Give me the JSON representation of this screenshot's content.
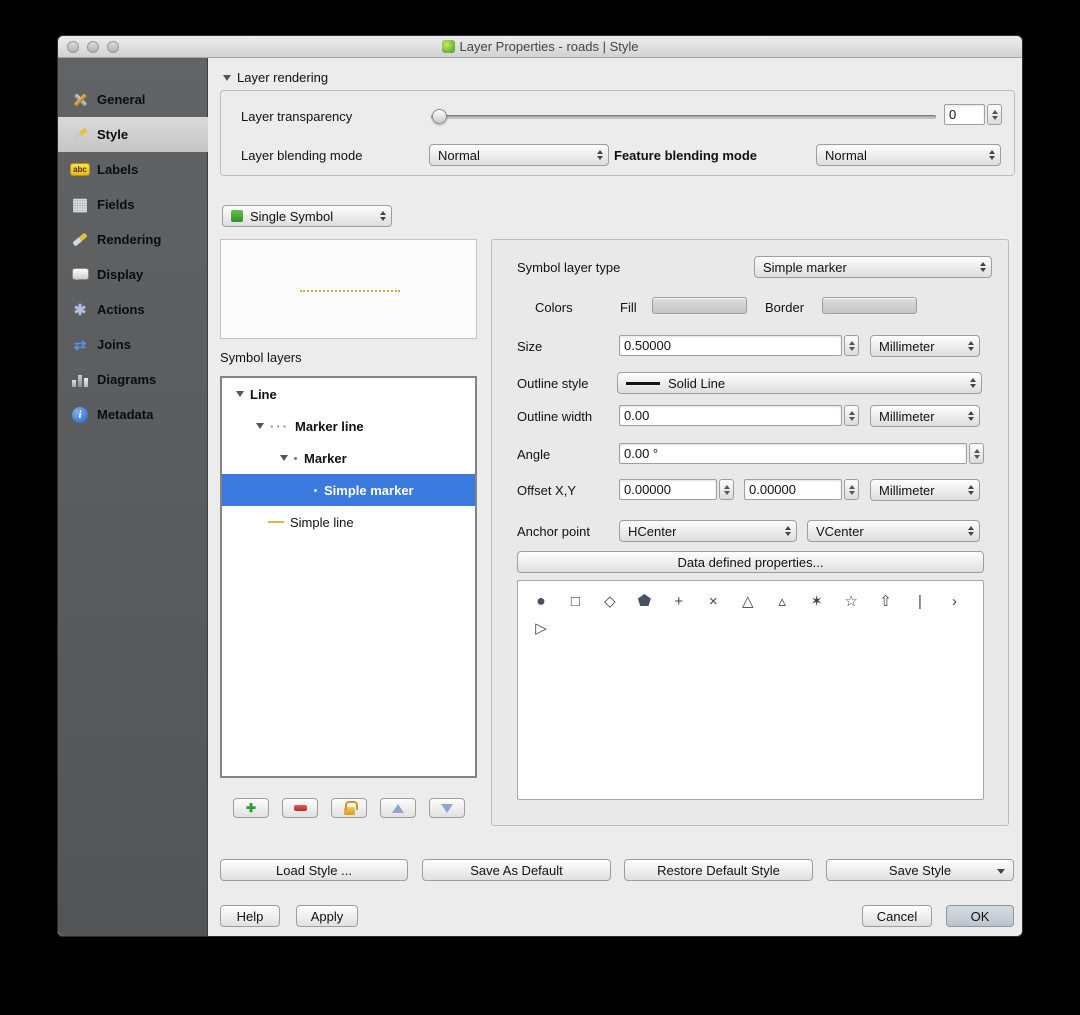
{
  "window": {
    "title": "Layer Properties - roads | Style"
  },
  "theme": {
    "selection_blue": "#3b79de",
    "sidebar_gray": "#58595b",
    "fill_swatch_color": "#d3d3d3",
    "border_swatch_color": "#cccccc",
    "preview_line_color": "#e0a43c"
  },
  "sidebar": {
    "items": [
      {
        "label": "General",
        "icon": "general-icon"
      },
      {
        "label": "Style",
        "icon": "style-icon",
        "selected": true
      },
      {
        "label": "Labels",
        "icon": "labels-icon"
      },
      {
        "label": "Fields",
        "icon": "fields-icon"
      },
      {
        "label": "Rendering",
        "icon": "rendering-icon"
      },
      {
        "label": "Display",
        "icon": "display-icon"
      },
      {
        "label": "Actions",
        "icon": "actions-icon"
      },
      {
        "label": "Joins",
        "icon": "joins-icon"
      },
      {
        "label": "Diagrams",
        "icon": "diagrams-icon"
      },
      {
        "label": "Metadata",
        "icon": "metadata-icon"
      }
    ]
  },
  "layer_rendering": {
    "title": "Layer rendering",
    "transparency_label": "Layer transparency",
    "transparency_value": "0",
    "blending_mode_label": "Layer blending mode",
    "blending_mode_value": "Normal",
    "feature_blending_label": "Feature blending mode",
    "feature_blending_value": "Normal"
  },
  "symbol_selector": {
    "value": "Single Symbol"
  },
  "symbol_layers": {
    "label": "Symbol layers",
    "tree": [
      {
        "label": "Line"
      },
      {
        "label": "Marker line"
      },
      {
        "label": "Marker"
      },
      {
        "label": "Simple marker",
        "selected": true
      },
      {
        "label": "Simple line"
      }
    ]
  },
  "properties": {
    "symbol_layer_type_label": "Symbol layer type",
    "symbol_layer_type_value": "Simple marker",
    "colors_label": "Colors",
    "fill_label": "Fill",
    "border_label": "Border",
    "size_label": "Size",
    "size_value": "0.50000",
    "size_unit": "Millimeter",
    "outline_style_label": "Outline style",
    "outline_style_value": "Solid Line",
    "outline_width_label": "Outline width",
    "outline_width_value": "0.00",
    "outline_width_unit": "Millimeter",
    "angle_label": "Angle",
    "angle_value": "0.00 °",
    "offset_label": "Offset X,Y",
    "offset_x_value": "0.00000",
    "offset_y_value": "0.00000",
    "offset_unit": "Millimeter",
    "anchor_label": "Anchor point",
    "anchor_h_value": "HCenter",
    "anchor_v_value": "VCenter",
    "data_defined_button": "Data defined properties..."
  },
  "shapes": [
    {
      "name": "circle",
      "glyph": "●"
    },
    {
      "name": "square",
      "glyph": "□"
    },
    {
      "name": "diamond",
      "glyph": "◇"
    },
    {
      "name": "pentagon",
      "glyph": "⬠"
    },
    {
      "name": "plus",
      "glyph": "+"
    },
    {
      "name": "cross",
      "glyph": "×"
    },
    {
      "name": "triangle",
      "glyph": "△"
    },
    {
      "name": "equilateral-triangle",
      "glyph": "▵"
    },
    {
      "name": "star-thin",
      "glyph": "✶"
    },
    {
      "name": "star",
      "glyph": "☆"
    },
    {
      "name": "arrow-up",
      "glyph": "⇧"
    },
    {
      "name": "line",
      "glyph": "|"
    },
    {
      "name": "chevron",
      "glyph": "›"
    },
    {
      "name": "arrowhead",
      "glyph": "▷"
    }
  ],
  "buttons": {
    "load_style": "Load Style ...",
    "save_as_default": "Save As Default",
    "restore_default": "Restore Default Style",
    "save_style": "Save Style",
    "help": "Help",
    "apply": "Apply",
    "cancel": "Cancel",
    "ok": "OK"
  }
}
